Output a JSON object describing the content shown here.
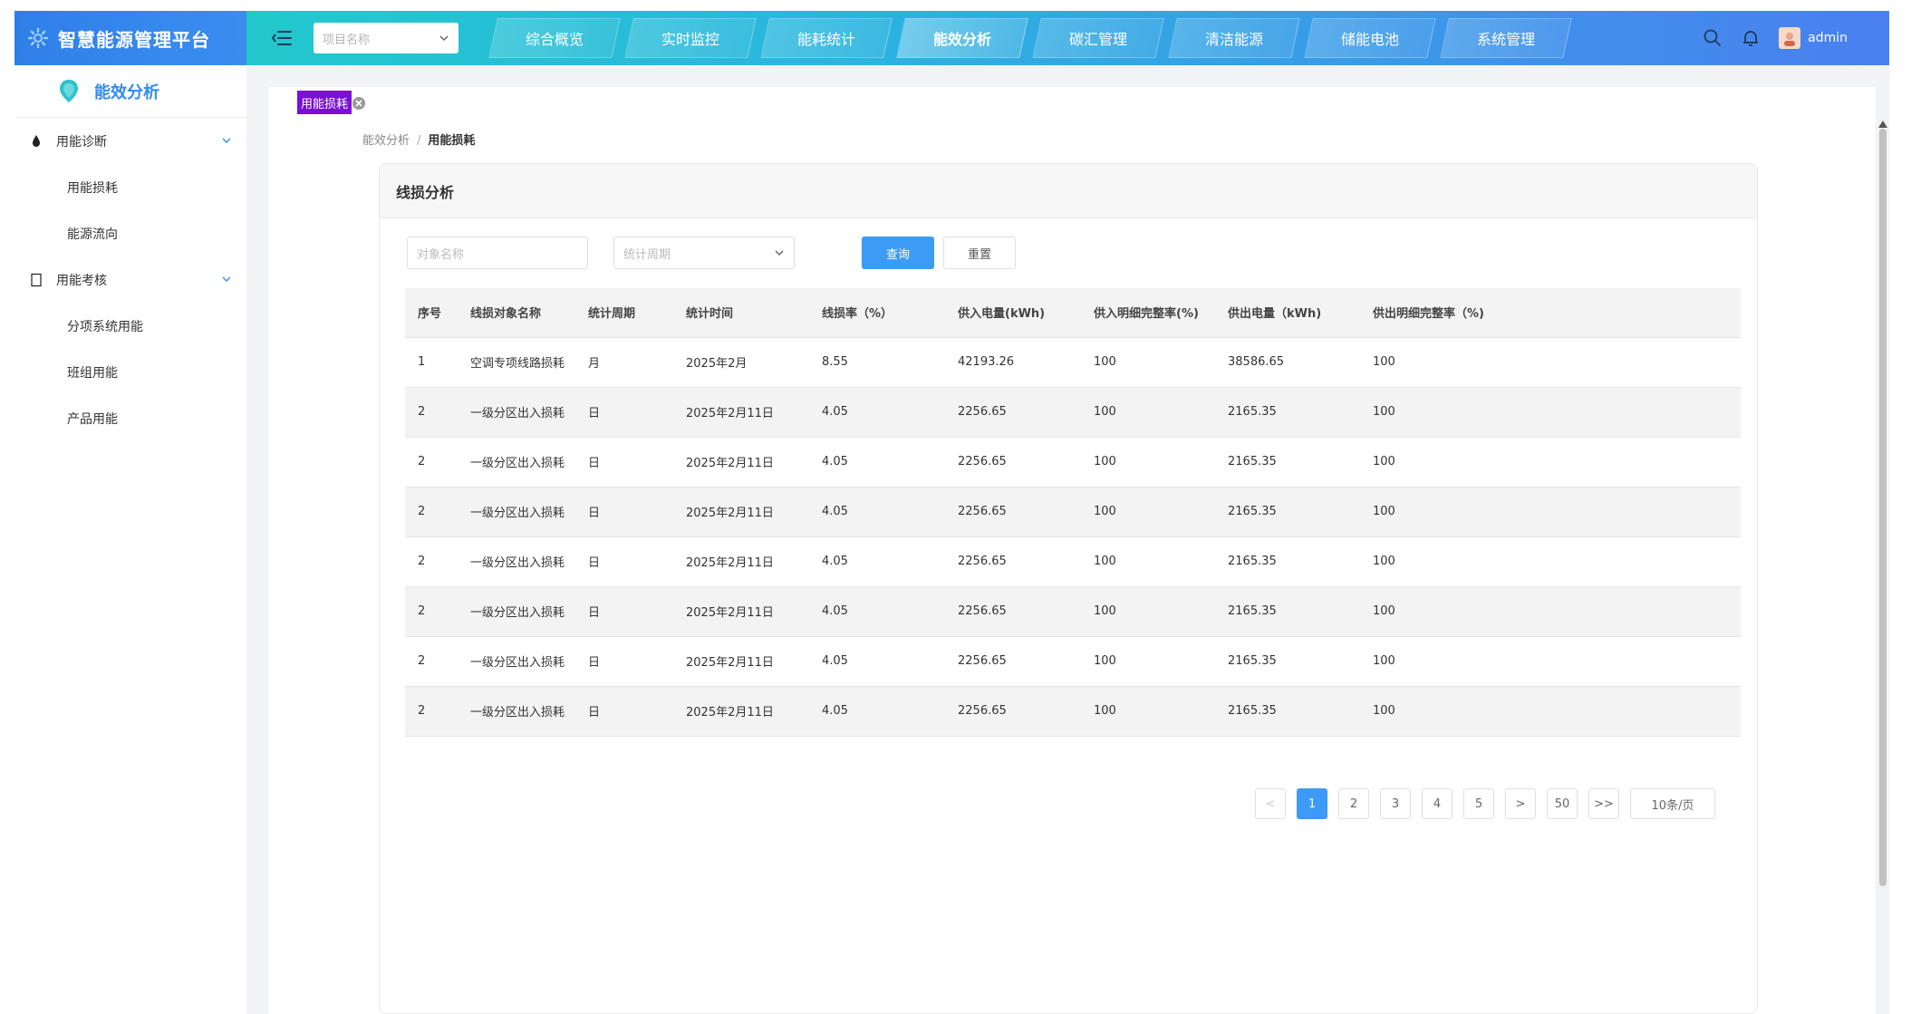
{
  "header": {
    "brand_title": "智慧能源管理平台",
    "project_placeholder": "项目名称",
    "nav": [
      "综合概览",
      "实时监控",
      "能耗统计",
      "能效分析",
      "碳汇管理",
      "清洁能源",
      "储能电池",
      "系统管理"
    ],
    "active_nav": "能效分析",
    "username": "admin"
  },
  "sidebar": {
    "title": "能效分析",
    "groups": [
      {
        "label": "用能诊断",
        "items": [
          "用能损耗",
          "能源流向"
        ]
      },
      {
        "label": "用能考核",
        "items": [
          "分项系统用能",
          "班组用能",
          "产品用能"
        ]
      }
    ]
  },
  "tab": {
    "label": "用能损耗"
  },
  "breadcrumb": {
    "parent": "能效分析",
    "separator": "/",
    "current": "用能损耗"
  },
  "card": {
    "title": "线损分析",
    "filter": {
      "name_placeholder": "对象名称",
      "period_placeholder": "统计周期"
    },
    "buttons": {
      "query": "查询",
      "reset": "重置"
    }
  },
  "table": {
    "columns": [
      "序号",
      "线损对象名称",
      "统计周期",
      "统计时间",
      "线损率（%）",
      "供入电量(kWh)",
      "供入明细完整率(%)",
      "供出电量（kWh)",
      "供出明细完整率（%)"
    ],
    "rows": [
      [
        "1",
        "空调专项线路损耗",
        "月",
        "2025年2月",
        "8.55",
        "42193.26",
        "100",
        "38586.65",
        "100"
      ],
      [
        "2",
        "一级分区出入损耗",
        "日",
        "2025年2月11日",
        "4.05",
        "2256.65",
        "100",
        "2165.35",
        "100"
      ],
      [
        "2",
        "一级分区出入损耗",
        "日",
        "2025年2月11日",
        "4.05",
        "2256.65",
        "100",
        "2165.35",
        "100"
      ],
      [
        "2",
        "一级分区出入损耗",
        "日",
        "2025年2月11日",
        "4.05",
        "2256.65",
        "100",
        "2165.35",
        "100"
      ],
      [
        "2",
        "一级分区出入损耗",
        "日",
        "2025年2月11日",
        "4.05",
        "2256.65",
        "100",
        "2165.35",
        "100"
      ],
      [
        "2",
        "一级分区出入损耗",
        "日",
        "2025年2月11日",
        "4.05",
        "2256.65",
        "100",
        "2165.35",
        "100"
      ],
      [
        "2",
        "一级分区出入损耗",
        "日",
        "2025年2月11日",
        "4.05",
        "2256.65",
        "100",
        "2165.35",
        "100"
      ],
      [
        "2",
        "一级分区出入损耗",
        "日",
        "2025年2月11日",
        "4.05",
        "2256.65",
        "100",
        "2165.35",
        "100"
      ]
    ]
  },
  "pagination": {
    "prev": "<",
    "pages": [
      "1",
      "2",
      "3",
      "4",
      "5"
    ],
    "next": ">",
    "last_page": "50",
    "jump": ">>",
    "current": "1",
    "page_size": "10条/页"
  },
  "colors": {
    "accent": "#3d9bf7",
    "tag": "#7a0fd8",
    "header_start": "#1fd0c5",
    "header_end": "#4a7ff0"
  }
}
